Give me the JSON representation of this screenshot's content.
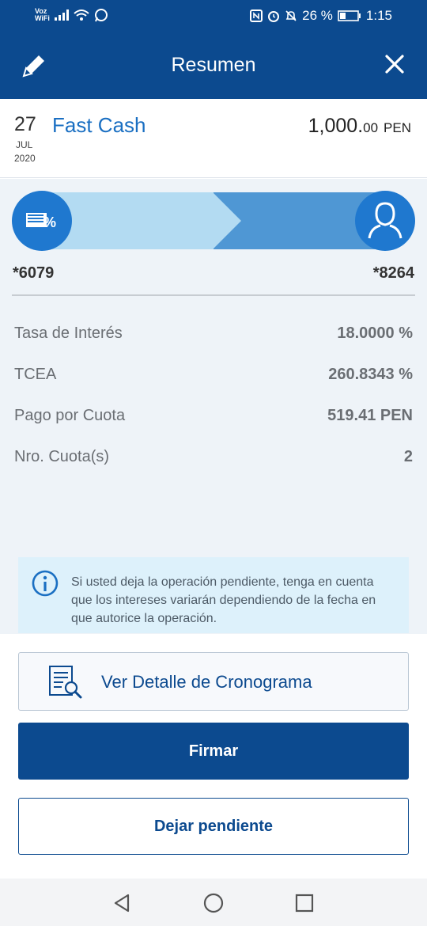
{
  "status_bar": {
    "carrier_top": "Voz",
    "carrier_bottom": "WiFi",
    "battery": "26 %",
    "time": "1:15"
  },
  "header": {
    "title": "Resumen"
  },
  "summary": {
    "day": "27",
    "month": "JUL",
    "year": "2020",
    "product": "Fast Cash",
    "amount_main": "1,000.",
    "amount_decimals": "00",
    "currency": "PEN"
  },
  "transfer": {
    "from_account": "*6079",
    "to_account": "*8264"
  },
  "details": [
    {
      "label": "Tasa de Interés",
      "value": "18.0000 %"
    },
    {
      "label": "TCEA",
      "value": "260.8343 %"
    },
    {
      "label": "Pago por Cuota",
      "value": "519.41 PEN"
    },
    {
      "label": "Nro. Cuota(s)",
      "value": "2"
    }
  ],
  "notice": {
    "text": "Si usted deja la operación pendiente, tenga en cuenta que los intereses variarán dependiendo de la fecha en que autorice la operación."
  },
  "actions": {
    "detail_label": "Ver Detalle de Cronograma",
    "sign_label": "Firmar",
    "pending_label": "Dejar pendiente"
  },
  "colors": {
    "primary": "#0c4a8f",
    "accent": "#1a6fc2",
    "notice_bg": "#ddf1fb"
  }
}
